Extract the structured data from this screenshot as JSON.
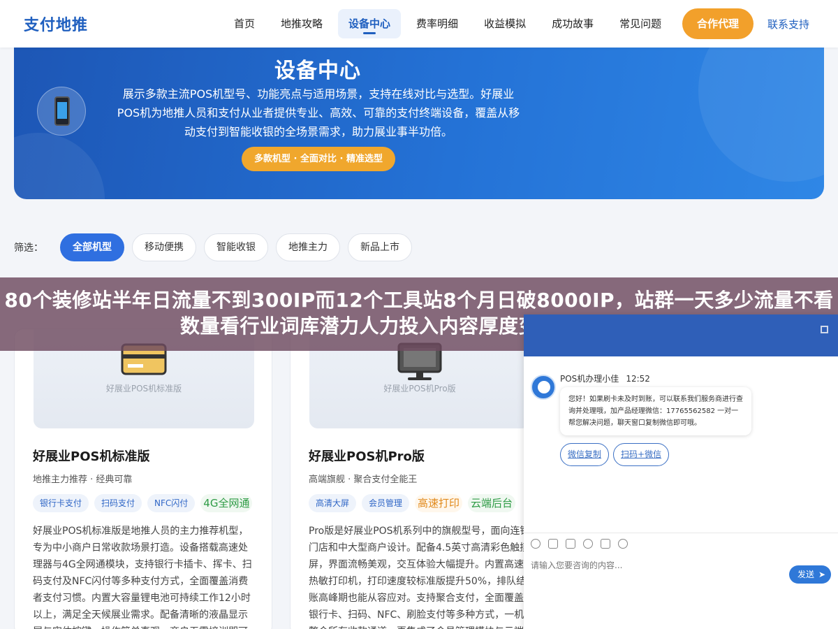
{
  "nav": {
    "logo": "支付地推",
    "links": [
      "首页",
      "地推攻略",
      "设备中心",
      "费率明细",
      "收益模拟",
      "成功故事",
      "常见问题"
    ],
    "partner": "合作代理",
    "support": "联系支持"
  },
  "hero": {
    "title": "设备中心",
    "desc": "展示多款主流POS机型号、功能亮点与适用场景，支持在线对比与选型。好展业POS机为地推人员和支付从业者提供专业、高效、可靠的支付终端设备，覆盖从移动支付到智能收银的全场景需求，助力展业事半功倍。",
    "badge": "多款机型 · 全面对比 · 精准选型"
  },
  "filter": {
    "label": "筛选：",
    "chips": [
      "全部机型",
      "移动便携",
      "智能收银",
      "地推主力",
      "新品上市"
    ]
  },
  "cards": [
    {
      "img_label": "好展业POS机标准版",
      "title": "好展业POS机标准版",
      "sub": "地推主力推荐 · 经典可靠",
      "tags": [
        "银行卡支付",
        "扫码支付",
        "NFC闪付",
        "4G全网通"
      ],
      "desc": "好展业POS机标准版是地推人员的主力推荐机型，专为中小商户日常收款场景打造。设备搭载高速处理器与4G全网通模块，支持银行卡插卡、挥卡、扫码支付及NFC闪付等多种支付方式，全面覆盖消费者支付习惯。内置大容量锂电池可持续工作12小时以上，满足全天候展业需求。配备清晰的液晶显示屏与实体按键，操作简单直观，商户无需培训即可"
    },
    {
      "img_label": "好展业POS机Pro版",
      "title": "好展业POS机Pro版",
      "sub": "高端旗舰 · 聚合支付全能王",
      "tags": [
        "高清大屏",
        "会员管理",
        "高速打印",
        "云端后台"
      ],
      "desc": "Pro版是好展业POS机系列中的旗舰型号，面向连锁门店和中大型商户设计。配备4.5英寸高清彩色触摸屏，界面流畅美观，交互体验大幅提升。内置高速热敏打印机，打印速度较标准版提升50%，排队结账高峰期也能从容应对。支持聚合支付，全面覆盖银行卡、扫码、NFC、刷脸支付等多种方式，一机整合所有收款通道，再集成了会员管理模块与云端"
    }
  ],
  "banner": "80个装修站半年日流量不到300IP而12个工具站8个月日破8000IP，站群一天多少流量不看数量看行业词库潜力人力投入内容厚度变现能力五变量",
  "chat": {
    "agent": "POS机办理小佳",
    "time": "12:52",
    "message": "您好！如果刷卡未及时到账，可以联系我们服务商进行查询并处理哦，加产品经理微信：17765562582 一对一帮您解决问题，聊天窗口复制微信即可哦。",
    "quick": [
      "微信复制",
      "扫码+微信"
    ],
    "placeholder": "请输入您要咨询的内容...",
    "send": "发送"
  }
}
